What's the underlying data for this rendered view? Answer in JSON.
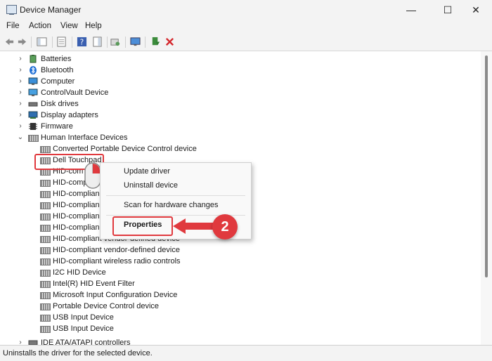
{
  "window": {
    "title": "Device Manager",
    "minimize": "—",
    "maximize": "☐",
    "close": "✕"
  },
  "menu": [
    "File",
    "Action",
    "View",
    "Help"
  ],
  "tree": {
    "categories_top": [
      {
        "label": "Batteries",
        "icon": "battery-icon"
      },
      {
        "label": "Bluetooth",
        "icon": "bluetooth-icon"
      },
      {
        "label": "Computer",
        "icon": "computer-icon"
      },
      {
        "label": "ControlVault Device",
        "icon": "monitor-icon"
      },
      {
        "label": "Disk drives",
        "icon": "disk-drive-icon"
      },
      {
        "label": "Display adapters",
        "icon": "display-adapter-icon"
      },
      {
        "label": "Firmware",
        "icon": "firmware-icon"
      },
      {
        "label": "Human Interface Devices",
        "icon": "hid-icon"
      }
    ],
    "hid_children": [
      "Converted Portable Device Control device",
      "Dell Touchpad",
      "HID-com",
      "HID-comp",
      "HID-complian",
      "HID-complian",
      "HID-complian",
      "HID-complian",
      "HID-compliant vendor-defined device",
      "HID-compliant vendor-defined device",
      "HID-compliant wireless radio controls",
      "I2C HID Device",
      "Intel(R) HID Event Filter",
      "Microsoft Input Configuration Device",
      "Portable Device Control device",
      "USB Input Device",
      "USB Input Device"
    ],
    "categories_bottom": [
      {
        "label": "IDE ATA/ATAPI controllers",
        "icon": "ide-icon"
      }
    ]
  },
  "context_menu": {
    "update_driver": "Update driver",
    "uninstall_device": "Uninstall device",
    "scan": "Scan for hardware changes",
    "properties": "Properties"
  },
  "annotation": {
    "step": "2"
  },
  "status": {
    "text": "Uninstalls the driver for the selected device."
  },
  "colors": {
    "accent_red": "#e0393e",
    "chrome": "#f3f3f3"
  }
}
